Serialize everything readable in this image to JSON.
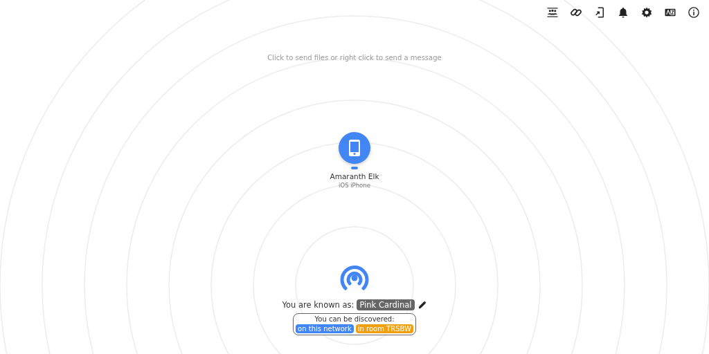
{
  "hint": "Click to send files or right click to send a message",
  "peers": [
    {
      "name": "Amaranth Elk",
      "device": "iOS iPhone"
    }
  ],
  "self": {
    "label": "You are known as:",
    "name": "Pink Cardinal"
  },
  "discovery": {
    "label": "You can be discovered:",
    "badges": [
      {
        "text": "on this network",
        "color": "#4285f4"
      },
      {
        "text": "in room TRSBW",
        "color": "#f29f0c"
      }
    ]
  }
}
